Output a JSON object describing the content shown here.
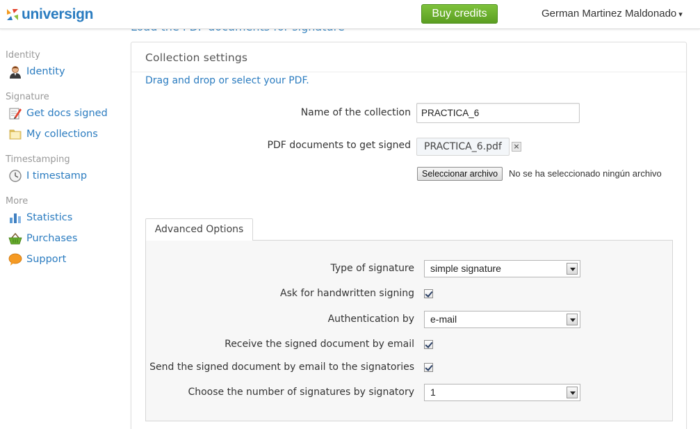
{
  "header": {
    "logo_text": "universign",
    "buy_credits_label": "Buy credits",
    "user_name": "German Martinez Maldonado",
    "user_caret": "▾",
    "page_heading_partial": "Load the PDF documents for signature"
  },
  "sidebar": {
    "groups": [
      {
        "label": "Identity"
      },
      {
        "label": "Signature"
      },
      {
        "label": "Timestamping"
      },
      {
        "label": "More"
      }
    ],
    "items": [
      {
        "label": "Identity",
        "icon": "user-icon"
      },
      {
        "label": "Get docs signed",
        "icon": "pen-document-icon"
      },
      {
        "label": "My collections",
        "icon": "folder-icon"
      },
      {
        "label": "I timestamp",
        "icon": "clock-icon"
      },
      {
        "label": "Statistics",
        "icon": "bar-chart-icon"
      },
      {
        "label": "Purchases",
        "icon": "basket-icon"
      },
      {
        "label": "Support",
        "icon": "speech-bubble-icon"
      }
    ]
  },
  "collection": {
    "title": "Collection settings",
    "drag_text": "Drag and drop or select your PDF.",
    "name_label": "Name of the collection",
    "name_value": "PRACTICA_6",
    "pdf_label": "PDF documents to get signed",
    "pdf_file": "PRACTICA_6.pdf",
    "remove_symbol": "×",
    "file_button_label": "Seleccionar archivo",
    "file_status": "No se ha seleccionado ningún archivo"
  },
  "advanced": {
    "tab_label": "Advanced Options",
    "type_label": "Type of signature",
    "type_value": "simple signature",
    "handwritten_label": "Ask for handwritten signing",
    "auth_label": "Authentication by",
    "auth_value": "e-mail",
    "receive_label": "Receive the signed document by email",
    "send_label": "Send the signed document by email to the signatories",
    "number_label": "Choose the number of signatures by signatory",
    "number_value": "1",
    "checkboxes": {
      "handwritten": true,
      "receive": true,
      "send": true
    }
  },
  "colors": {
    "link": "#2b7cc0",
    "buy_button": "#6aae2f",
    "logo": "#2a7cc0"
  }
}
